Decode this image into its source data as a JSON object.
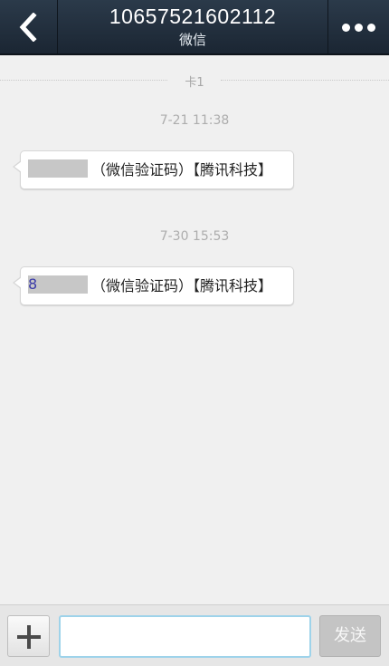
{
  "header": {
    "title": "10657521602112",
    "subtitle": "微信"
  },
  "chat": {
    "sim_label": "卡1",
    "messages": [
      {
        "timestamp": "7-21 11:38",
        "text": "（微信验证码）【腾讯科技】",
        "redacted": true
      },
      {
        "timestamp": "7-30 15:53",
        "leading_digit": "8",
        "text": "（微信验证码）【腾讯科技】",
        "redacted": true
      }
    ]
  },
  "input_bar": {
    "message_value": "",
    "send_label": "发送"
  },
  "icons": {
    "back": "back-arrow-icon",
    "more": "more-dots-icon",
    "add": "plus-icon"
  },
  "colors": {
    "header_bg": "#1f2b38",
    "chat_bg": "#f0f0f0",
    "input_border": "#9ed3ea"
  }
}
